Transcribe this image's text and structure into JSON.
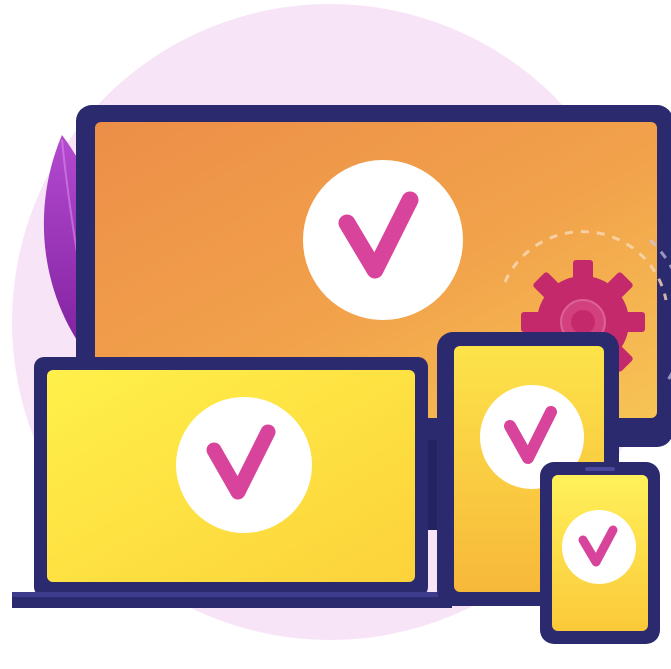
{
  "illustration": {
    "devices": [
      "monitor",
      "laptop",
      "tablet",
      "phone"
    ],
    "status_mark": "check-icon",
    "decorations": [
      "leaf-icon",
      "gear-icon"
    ],
    "colors": {
      "background_blob": "#f8e4f7",
      "device_frame": "#2b2a6e",
      "monitor_screen_light": "#f5b552",
      "monitor_screen_dark": "#ec8a45",
      "laptop_screen": "#fdea3c",
      "tablet_screen": "#fcd640",
      "check_circle": "#ffffff",
      "check_mark": "#d8449c",
      "leaf": "#a63bc6",
      "gear": "#c4296b"
    }
  }
}
